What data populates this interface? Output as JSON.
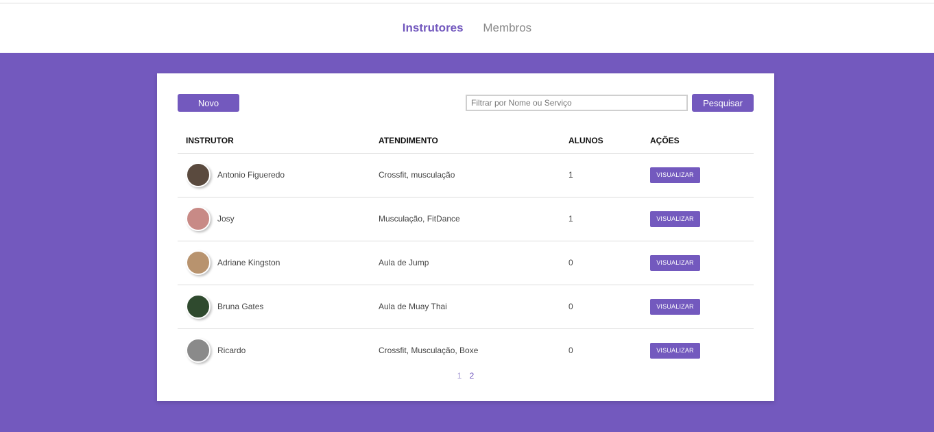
{
  "nav": {
    "tabs": [
      {
        "label": "Instrutores",
        "active": true
      },
      {
        "label": "Membros",
        "active": false
      }
    ]
  },
  "toolbar": {
    "new_label": "Novo",
    "search_placeholder": "Filtrar por Nome ou Serviço",
    "search_value": "",
    "search_label": "Pesquisar"
  },
  "table": {
    "headers": [
      "INSTRUTOR",
      "ATENDIMENTO",
      "ALUNOS",
      "AÇÕES"
    ],
    "rows": [
      {
        "name": "Antonio Figueredo",
        "service": "Crossfit, musculação",
        "students": "1",
        "action": "VISUALIZAR",
        "avatar_color": "#5a4a3e"
      },
      {
        "name": "Josy",
        "service": "Musculação, FitDance",
        "students": "1",
        "action": "VISUALIZAR",
        "avatar_color": "#c88a86"
      },
      {
        "name": "Adriane Kingston",
        "service": "Aula de Jump",
        "students": "0",
        "action": "VISUALIZAR",
        "avatar_color": "#b8936e"
      },
      {
        "name": "Bruna Gates",
        "service": "Aula de Muay Thai",
        "students": "0",
        "action": "VISUALIZAR",
        "avatar_color": "#2f4a2e"
      },
      {
        "name": "Ricardo",
        "service": "Crossfit, Musculação, Boxe",
        "students": "0",
        "action": "VISUALIZAR",
        "avatar_color": "#8a8a8a"
      }
    ]
  },
  "pagination": {
    "pages": [
      "1",
      "2"
    ],
    "current": "1"
  },
  "colors": {
    "accent": "#7359be",
    "background": "#7359be",
    "card": "#ffffff"
  }
}
